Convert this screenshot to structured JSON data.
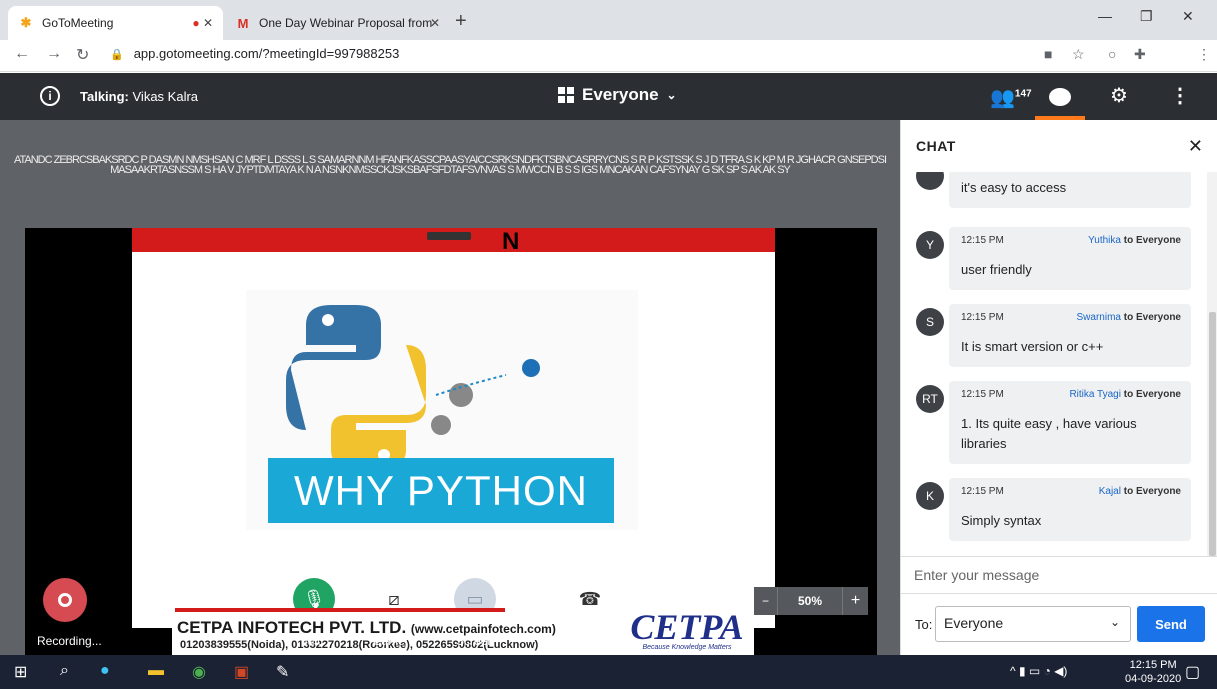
{
  "browser": {
    "tabs": [
      {
        "title": "GoToMeeting",
        "icon": "gotomeeting-icon"
      },
      {
        "title": "One Day Webinar Proposal from",
        "icon": "gmail-icon"
      }
    ],
    "url": "app.gotomeeting.com/?meetingId=997988253"
  },
  "meeting": {
    "talking_label": "Talking:",
    "talking_name": "Vikas Kalra",
    "view_label": "Everyone",
    "attendee_count": "147",
    "name_strip": "ATANDC  ZEBRCSBAKSRDC P DASMN NMSHSAN C MRF L DSSS L  S SAMARNNM HFANFKASSCPAASYAICCSRKSNDFKTSBNCASRRYCNS S  R P KSTSSK S J D TFRA S  K KP M R JGHACR GNSEPDSI MASAAKRTASNSSM S HA V JYPTDMTAYA K N A NSNKNMSSCKJSKSBAFSFDTAFSVNVAS S MWCCN B S S IGS MNCAKAN CAFSYNAY G SK SP S AK   AK     SY"
  },
  "slide": {
    "title_fragment": "N",
    "headline": "WHY PYTHON",
    "banner_company": "CETPA INFOTECH PVT. LTD.",
    "banner_website": "(www.cetpainfotech.com)",
    "banner_phones": "01203839555(Noida), 01332270218(Roorkee), 05226590802(Lucknow)",
    "banner_logo": "CETPA",
    "banner_tagline": "Because Knowledge Matters"
  },
  "controls": {
    "recording": "Recording...",
    "mic": "Mic",
    "camera": "Camera",
    "screen": "Screen",
    "leave": "Leave",
    "zoom": "50%",
    "zoom_minus": "−",
    "zoom_plus": "+"
  },
  "chat": {
    "title": "CHAT",
    "messages": [
      {
        "initials": "",
        "time": "",
        "sender": "",
        "to": "",
        "text": "it's easy to access"
      },
      {
        "initials": "Y",
        "time": "12:15 PM",
        "sender": "Yuthika",
        "to": "to Everyone",
        "text": "user friendly"
      },
      {
        "initials": "S",
        "time": "12:15 PM",
        "sender": "Swarnima",
        "to": "to Everyone",
        "text": "It is smart version or c++"
      },
      {
        "initials": "RT",
        "time": "12:15 PM",
        "sender": "Ritika Tyagi",
        "to": "to Everyone",
        "text": "1. Its quite easy , have various libraries"
      },
      {
        "initials": "K",
        "time": "12:15 PM",
        "sender": "Kajal",
        "to": "to Everyone",
        "text": "Simply syntax"
      }
    ],
    "input_placeholder": "Enter your message",
    "to_label": "To:",
    "to_value": "Everyone",
    "send": "Send"
  },
  "taskbar": {
    "time": "12:15 PM",
    "date": "04-09-2020"
  },
  "colors": {
    "accent": "#1a73e8",
    "meeting_bar": "#2b2f33",
    "record": "#d64b52",
    "mic_on": "#1fa463",
    "orange": "#ff7a1a"
  }
}
